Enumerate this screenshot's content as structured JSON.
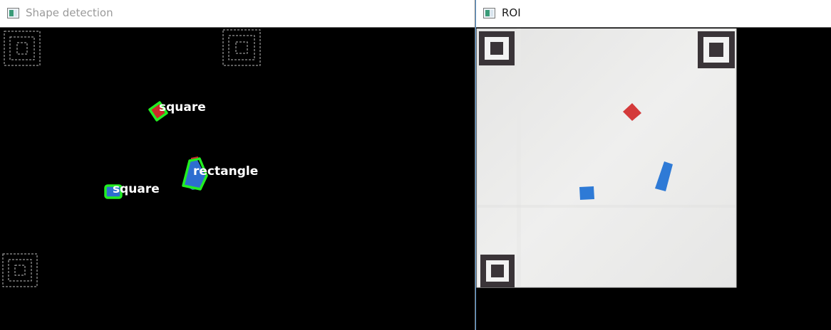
{
  "windows": {
    "shape_detection": {
      "title": "Shape detection",
      "labels": {
        "top_square": "square",
        "rectangle": "rectangle",
        "bottom_square": "square"
      }
    },
    "roi": {
      "title": "ROI"
    }
  },
  "icons": {
    "window_icon": "opencv-window-icon",
    "marker": "fiducial-marker"
  },
  "colors": {
    "contour": "#22ee22",
    "red_piece": "#d43a3a",
    "blue_piece": "#2e7ad6",
    "label_text": "#ffffff",
    "marker_dark": "#3a3438",
    "roi_background": "#ebebea"
  }
}
